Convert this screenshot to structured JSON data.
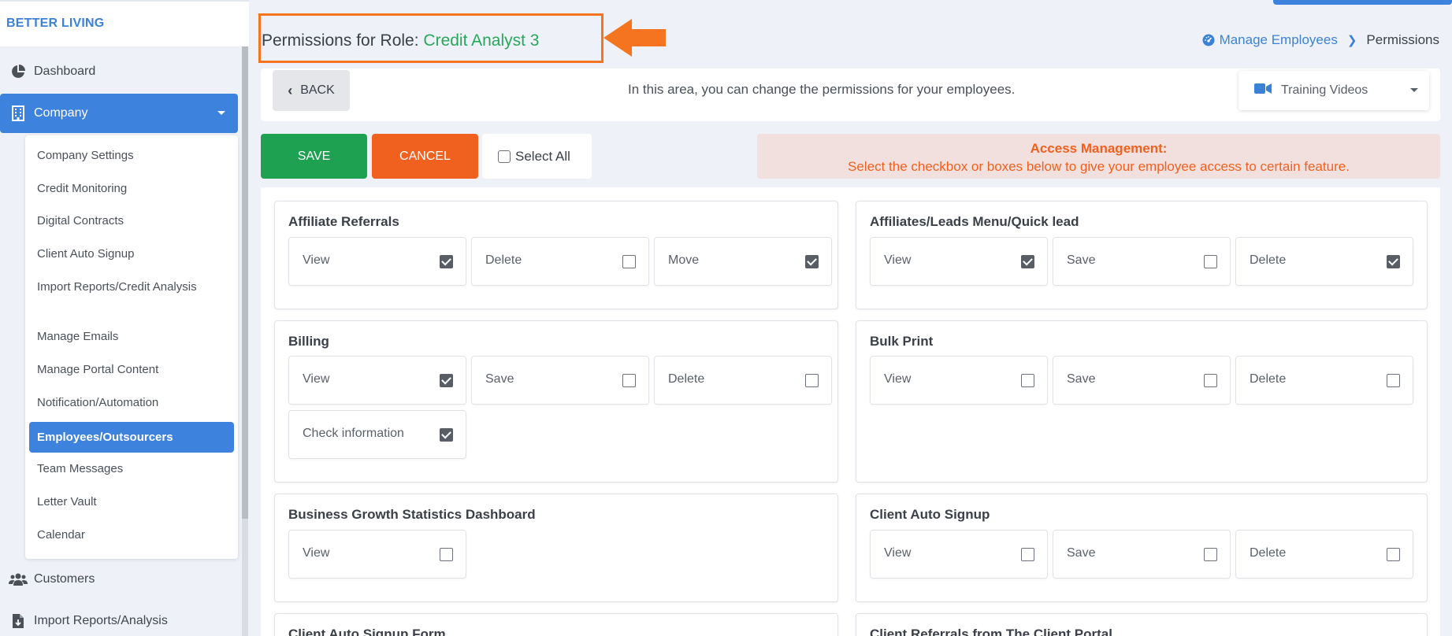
{
  "brand": "BETTER LIVING",
  "sidebar": {
    "dashboard": "Dashboard",
    "company": "Company",
    "company_submenu": [
      {
        "label": "Company Settings"
      },
      {
        "label": "Credit Monitoring"
      },
      {
        "label": "Digital Contracts"
      },
      {
        "label": "Client Auto Signup"
      },
      {
        "label": "Import Reports/Credit Analysis"
      },
      {
        "label": "Manage Emails"
      },
      {
        "label": "Manage Portal Content"
      },
      {
        "label": "Notification/Automation"
      },
      {
        "label": "Employees/Outsourcers"
      },
      {
        "label": "Team Messages"
      },
      {
        "label": "Letter Vault"
      },
      {
        "label": "Calendar"
      }
    ],
    "active_submenu": "Employees/Outsourcers",
    "customers": "Customers",
    "import_reports": "Import Reports/Analysis"
  },
  "header": {
    "title_prefix": "Permissions for Role:",
    "role_name": "Credit Analyst 3",
    "breadcrumb": {
      "parent": "Manage Employees",
      "current": "Permissions"
    }
  },
  "info_bar": {
    "back_label": "BACK",
    "message": "In this area, you can change the permissions for your employees.",
    "training_label": "Training Videos"
  },
  "actions": {
    "save_label": "SAVE",
    "cancel_label": "CANCEL",
    "select_all_label": "Select All",
    "select_all_checked": false
  },
  "access_note": {
    "title": "Access Management:",
    "text": "Select the checkbox or boxes below to give your employee access to certain feature."
  },
  "permissions": [
    {
      "title": "Affiliate Referrals",
      "items": [
        {
          "label": "View",
          "checked": true
        },
        {
          "label": "Delete",
          "checked": false
        },
        {
          "label": "Move",
          "checked": true
        }
      ]
    },
    {
      "title": "Affiliates/Leads Menu/Quick lead",
      "items": [
        {
          "label": "View",
          "checked": true
        },
        {
          "label": "Save",
          "checked": false
        },
        {
          "label": "Delete",
          "checked": true
        }
      ]
    },
    {
      "title": "Billing",
      "items": [
        {
          "label": "View",
          "checked": true
        },
        {
          "label": "Save",
          "checked": false
        },
        {
          "label": "Delete",
          "checked": false
        },
        {
          "label": "Check information",
          "checked": true
        }
      ]
    },
    {
      "title": "Bulk Print",
      "items": [
        {
          "label": "View",
          "checked": false
        },
        {
          "label": "Save",
          "checked": false
        },
        {
          "label": "Delete",
          "checked": false
        }
      ]
    },
    {
      "title": "Business Growth Statistics Dashboard",
      "items": [
        {
          "label": "View",
          "checked": false
        }
      ]
    },
    {
      "title": "Client Auto Signup",
      "items": [
        {
          "label": "View",
          "checked": false
        },
        {
          "label": "Save",
          "checked": false
        },
        {
          "label": "Delete",
          "checked": false
        }
      ]
    },
    {
      "title": "Client Auto Signup Form",
      "items": []
    },
    {
      "title": "Client Referrals from The Client Portal",
      "items": []
    }
  ],
  "colors": {
    "primary_blue": "#3d82dd",
    "save_green": "#1fa152",
    "cancel_orange": "#f0611f",
    "role_green": "#2aa65c",
    "highlight_orange": "#f4741f"
  }
}
